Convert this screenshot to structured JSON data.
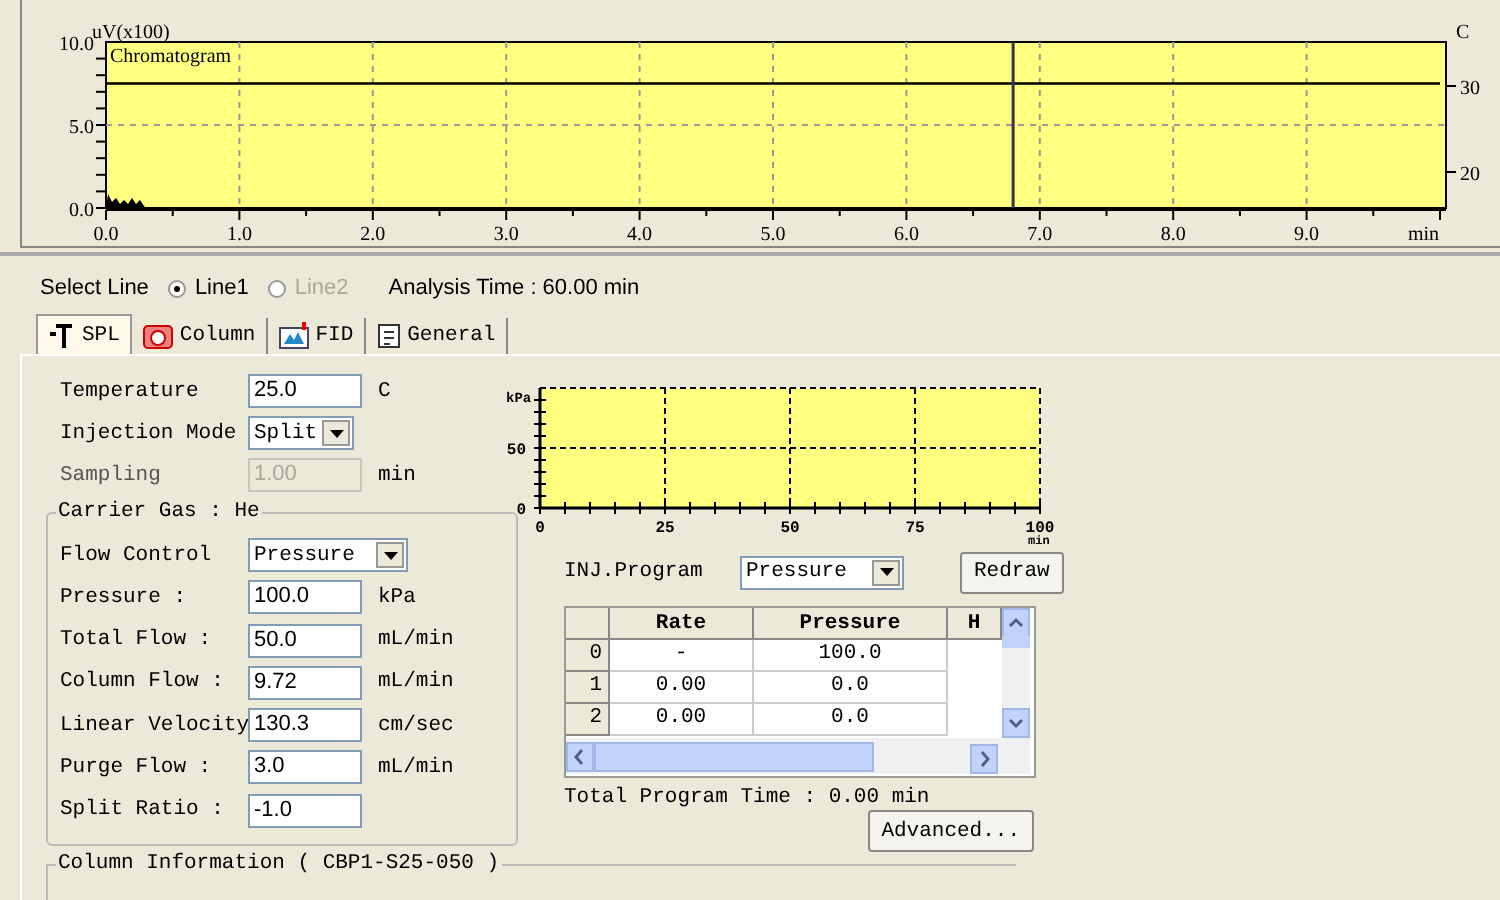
{
  "chromatogram": {
    "chart_data": {
      "type": "line",
      "title": "Chromatogram",
      "ylabel": "uV(x100)",
      "xlabel": "min",
      "xlim": [
        0,
        10
      ],
      "ylim": [
        0,
        10
      ],
      "xticks": [
        {
          "value": 0,
          "label": "0.0"
        },
        {
          "value": 1,
          "label": "1.0"
        },
        {
          "value": 2,
          "label": "2.0"
        },
        {
          "value": 3,
          "label": "3.0"
        },
        {
          "value": 4,
          "label": "4.0"
        },
        {
          "value": 5,
          "label": "5.0"
        },
        {
          "value": 6,
          "label": "6.0"
        },
        {
          "value": 7,
          "label": "7.0"
        },
        {
          "value": 8,
          "label": "8.0"
        },
        {
          "value": 9,
          "label": "9.0"
        }
      ],
      "yticks": [
        {
          "value": 0,
          "label": "0.0"
        },
        {
          "value": 5,
          "label": "5.0"
        },
        {
          "value": 10,
          "label": "10.0"
        }
      ],
      "x": [
        0,
        10
      ],
      "series": [
        {
          "color": "#000000",
          "values": [
            7.5,
            7.5
          ]
        }
      ],
      "ref_lines": [
        {
          "axis": "x",
          "value": 6.8
        }
      ],
      "grid": true
    },
    "right_axis": {
      "label": "C",
      "ticks": [
        "30",
        "20"
      ]
    }
  },
  "select_line": {
    "label": "Select Line",
    "options": [
      {
        "label": "Line1",
        "selected": true,
        "disabled": false
      },
      {
        "label": "Line2",
        "selected": false,
        "disabled": true
      }
    ]
  },
  "analysis_time": "Analysis Time : 60.00 min",
  "tabs": [
    {
      "label": "SPL",
      "selected": true
    },
    {
      "label": "Column",
      "selected": false
    },
    {
      "label": "FID",
      "selected": false
    },
    {
      "label": "General",
      "selected": false
    }
  ],
  "fields": [
    {
      "kind": "input",
      "label": "Temperature",
      "value": "25.0",
      "unit": "C",
      "disabled": false
    },
    {
      "kind": "dropdown",
      "label": "Injection Mode",
      "value": "Split"
    },
    {
      "kind": "input",
      "label": "Sampling",
      "value": "1.00",
      "unit": "min",
      "disabled": true
    }
  ],
  "carrier_gas": {
    "title": "Carrier Gas : He",
    "fields": [
      {
        "kind": "dropdown",
        "label": "Flow Control",
        "value": "Pressure"
      },
      {
        "kind": "input",
        "label": "Pressure :",
        "value": "100.0",
        "unit": "kPa",
        "disabled": false
      },
      {
        "kind": "input",
        "label": "Total Flow :",
        "value": "50.0",
        "unit": "mL/min",
        "disabled": false
      },
      {
        "kind": "input",
        "label": "Column Flow :",
        "value": "9.72",
        "unit": "mL/min",
        "disabled": false
      },
      {
        "kind": "input",
        "label": "Linear Velocity",
        "value": "130.3",
        "unit": "cm/sec",
        "disabled": false
      },
      {
        "kind": "input",
        "label": "Purge Flow :",
        "value": "3.0",
        "unit": "mL/min",
        "disabled": false
      },
      {
        "kind": "input",
        "label": "Split Ratio :",
        "value": "-1.0",
        "disabled": false
      }
    ]
  },
  "column_information": {
    "title": "Column Information ( CBP1-S25-050 )"
  },
  "pressure_chart": {
    "chart_data": {
      "type": "line",
      "ylabel": "kPa",
      "xlabel": "min",
      "xlim": [
        0,
        100
      ],
      "ylim": [
        0,
        100
      ],
      "xticks": [
        0,
        25,
        50,
        75,
        100
      ],
      "yticks": [
        0,
        50
      ],
      "grid": true
    }
  },
  "inj_program": {
    "label": "INJ.Program",
    "value": "Pressure"
  },
  "redraw_button": "Redraw",
  "program_table": {
    "columns": [
      "Rate",
      "Pressure",
      "H"
    ],
    "rows": [
      {
        "index": "0",
        "cells": [
          "-",
          "100.0"
        ]
      },
      {
        "index": "1",
        "cells": [
          "0.00",
          "0.0"
        ]
      },
      {
        "index": "2",
        "cells": [
          "0.00",
          "0.0"
        ]
      }
    ]
  },
  "total_program_time": "Total Program Time : 0.00 min",
  "advanced_button": "Advanced..."
}
